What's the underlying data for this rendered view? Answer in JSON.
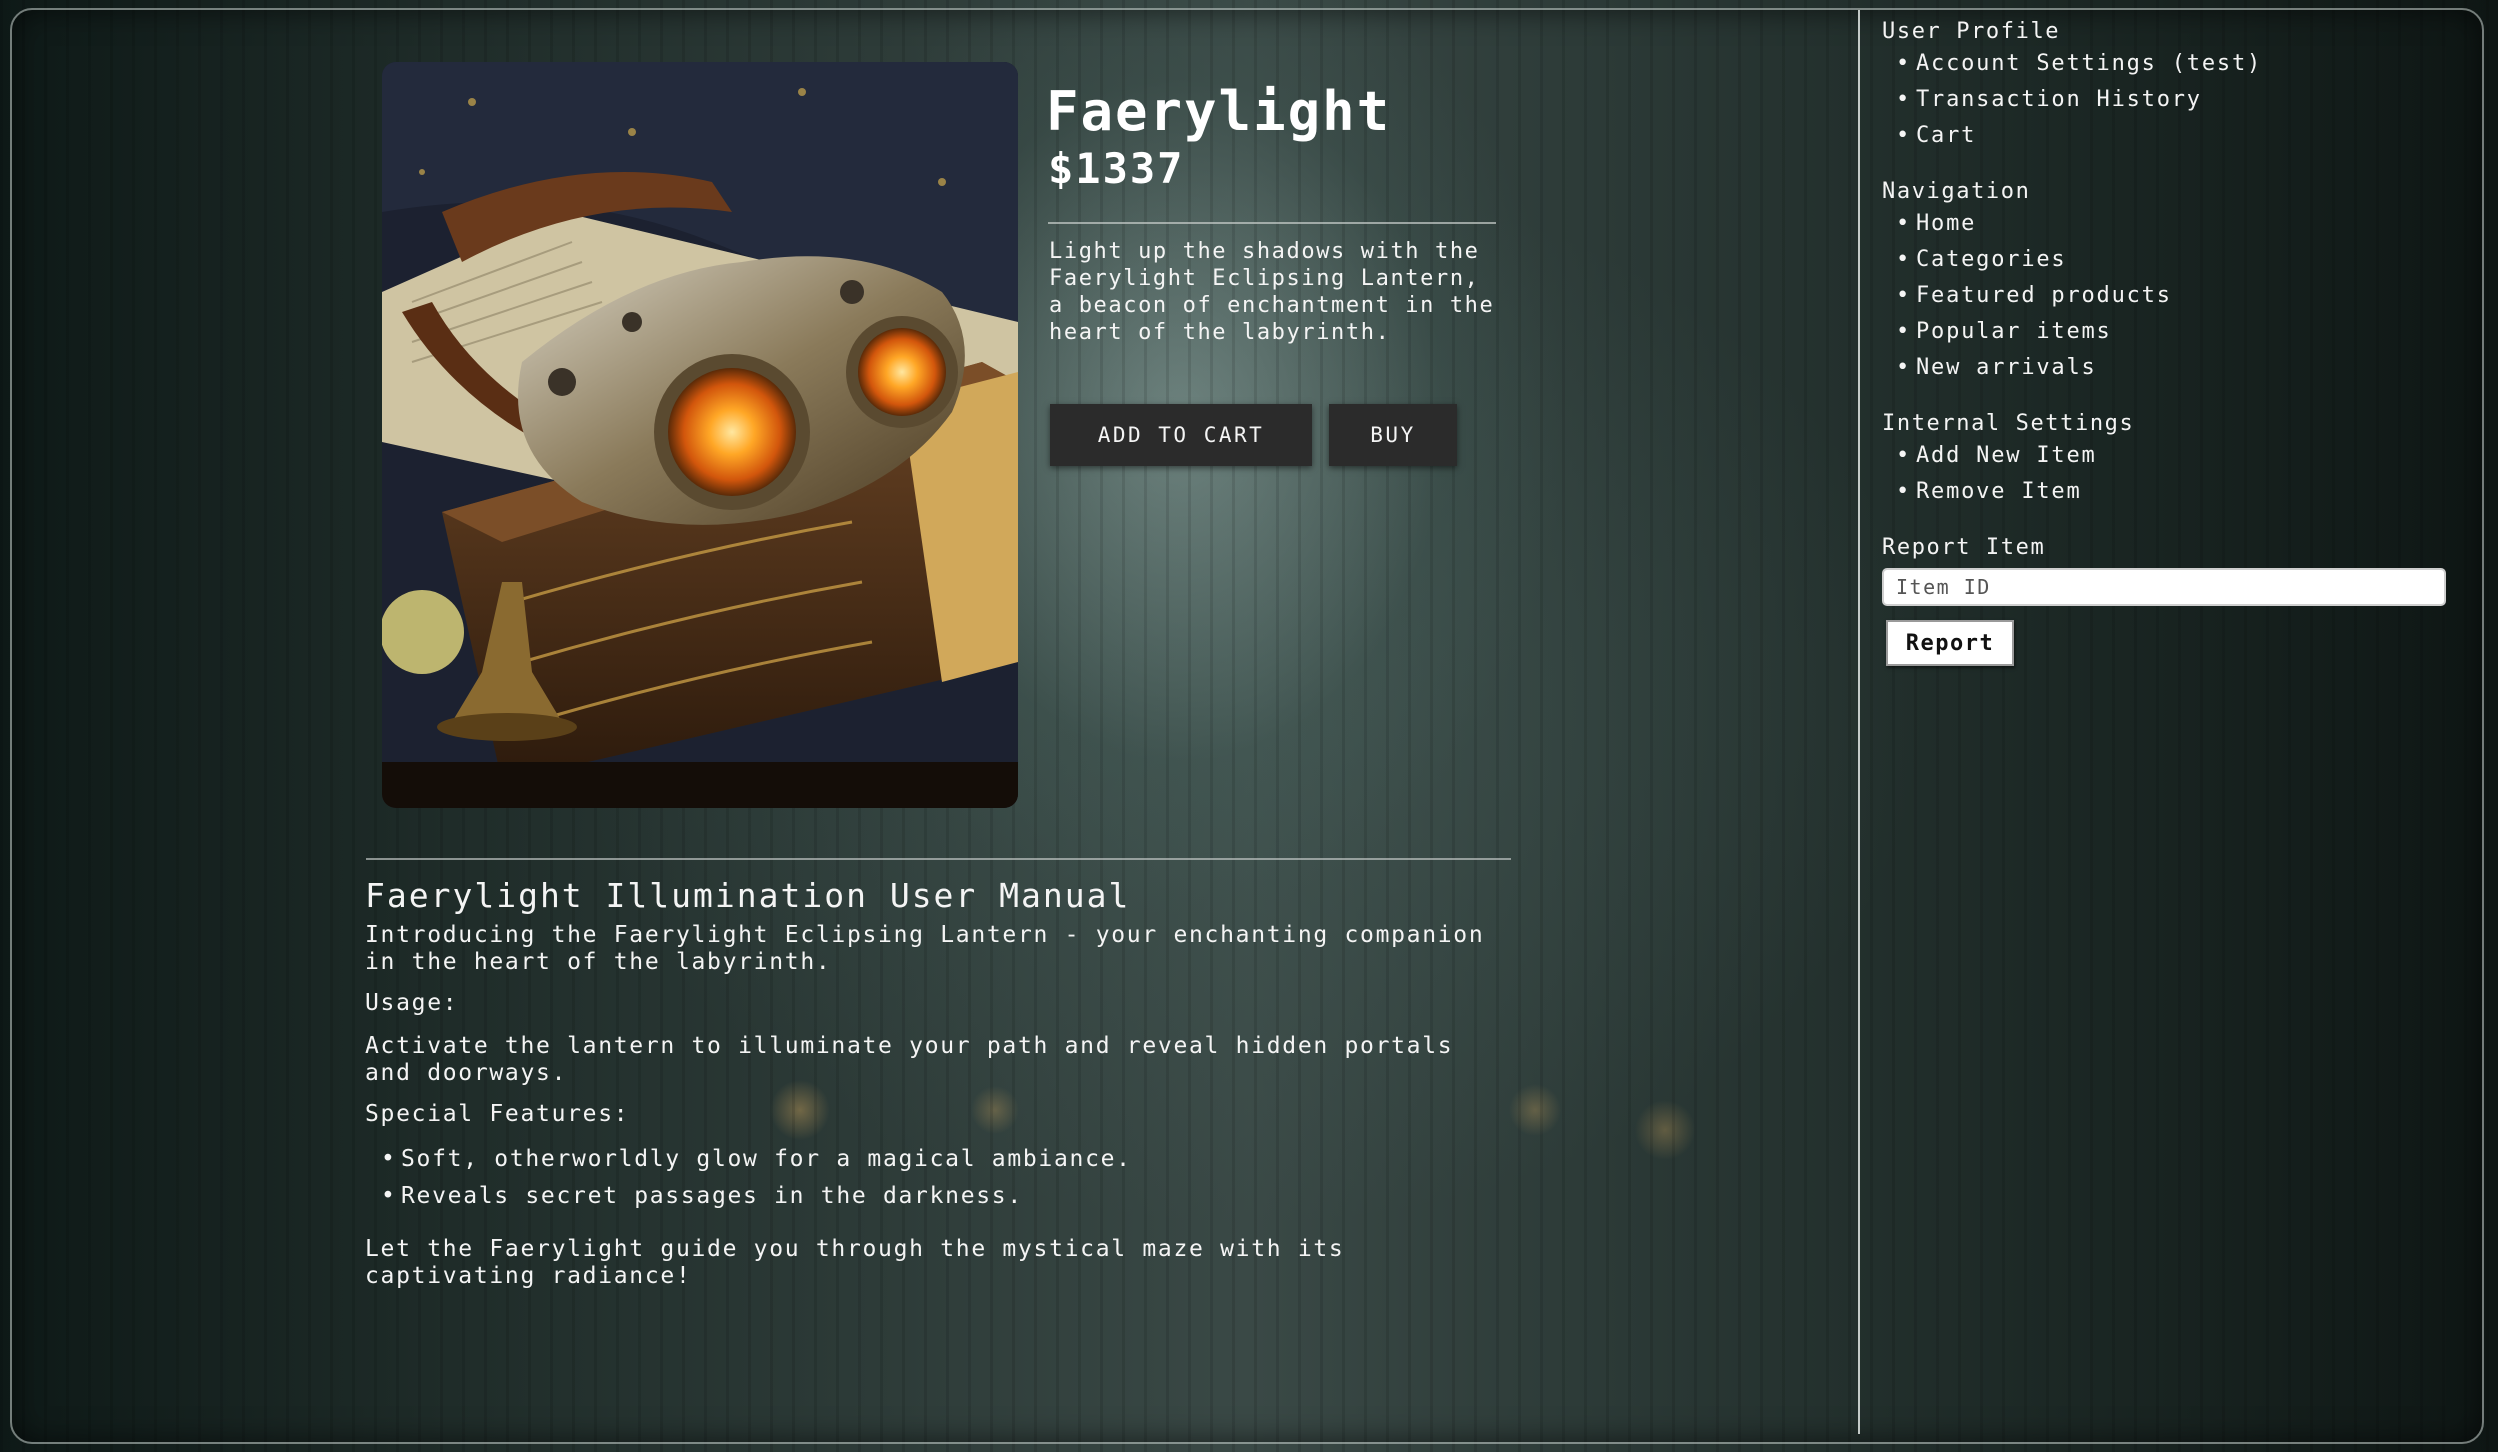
{
  "product": {
    "title": "Faerylight",
    "price": "$1337",
    "image_alt": "steampunk goggles on an old book",
    "short_description": "Light up the shadows with the Faerylight Eclipsing Lantern, a beacon of enchantment in the heart of the labyrinth.",
    "add_to_cart_label": "ADD TO CART",
    "buy_label": "BUY"
  },
  "manual": {
    "title": "Faerylight Illumination User Manual",
    "intro": "Introducing the Faerylight Eclipsing Lantern - your enchanting companion in the heart of the labyrinth.",
    "usage_heading": "Usage:",
    "usage_text": "Activate the lantern to illuminate your path and reveal hidden portals and doorways.",
    "features_heading": "Special Features:",
    "features": [
      "Soft, otherworldly glow for a magical ambiance.",
      "Reveals secret passages in the darkness."
    ],
    "closing": "Let the Faerylight guide you through the mystical maze with its captivating radiance!"
  },
  "sidebar": {
    "user_profile": {
      "heading": "User Profile",
      "items": [
        "Account Settings (test)",
        "Transaction History",
        "Cart"
      ]
    },
    "navigation": {
      "heading": "Navigation",
      "items": [
        "Home",
        "Categories",
        "Featured products",
        "Popular items",
        "New arrivals"
      ]
    },
    "internal_settings": {
      "heading": "Internal Settings",
      "items": [
        "Add New Item",
        "Remove Item"
      ]
    },
    "report": {
      "heading": "Report Item",
      "input_placeholder": "Item ID",
      "button_label": "Report"
    }
  }
}
